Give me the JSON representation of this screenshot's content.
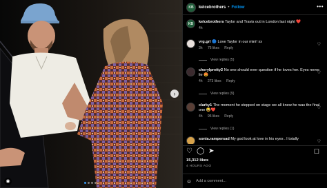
{
  "post": {
    "username": "kelcebrothers",
    "follow_label": "Follow",
    "caption_user": "kelcebrothers",
    "caption_text": "Taylor and Travis out in London last night ❤️",
    "caption_time": "4h",
    "likes": "15,312 likes",
    "date": "4 HOURS AGO",
    "add_comment_placeholder": "Add a comment...",
    "carousel_dots": 4
  },
  "comments": [
    {
      "user": "vrg.grl",
      "verified": "🔵",
      "text": "Love Taylor in our mini! xx",
      "time": "3h",
      "likes": "76 likes",
      "reply": "Reply",
      "view_replies": "View replies (5)"
    },
    {
      "user": "cherylpretty2",
      "text": "No one should ever question if he loves her. Eyes never lie 😍",
      "time": "4h",
      "likes": "273 likes",
      "reply": "Reply",
      "view_replies": "View replies (9)"
    },
    {
      "user": "clarky1",
      "text": "The moment he stepped on stage we all knew he was the final one 😂❤️",
      "time": "4h",
      "likes": "95 likes",
      "reply": "Reply",
      "view_replies": "View replies (1)"
    },
    {
      "user": "sonia.rampersad",
      "text": "My god look at love in his eyes . I totally",
      "time": "",
      "likes": "",
      "reply": "",
      "view_replies": ""
    }
  ],
  "colors": {
    "accent": "#0095f6",
    "background": "#000000",
    "muted": "#a8a8a8"
  },
  "icons": [
    "more-horizontal-icon",
    "heart-icon",
    "comment-icon",
    "share-icon",
    "bookmark-icon",
    "emoji-icon",
    "carousel-next-icon",
    "tagged-user-icon"
  ]
}
